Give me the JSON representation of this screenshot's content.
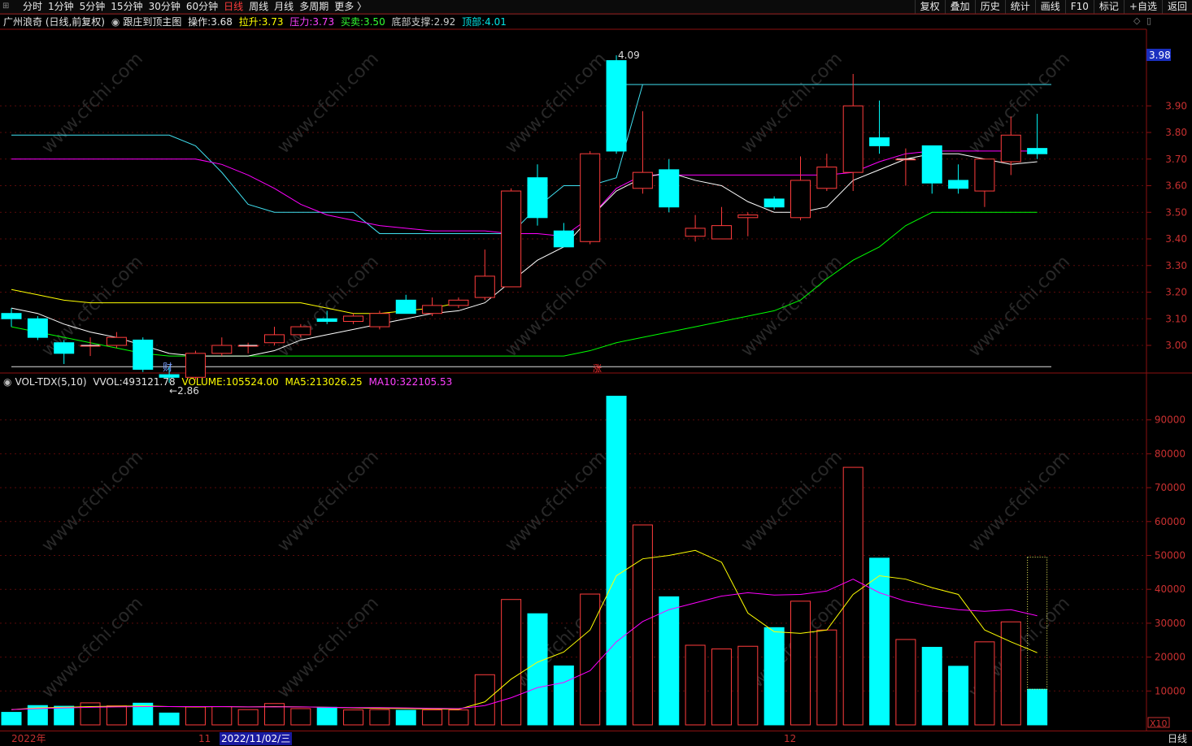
{
  "toolbar": {
    "periods": [
      "分时",
      "1分钟",
      "5分钟",
      "15分钟",
      "30分钟",
      "60分钟",
      "日线",
      "周线",
      "月线",
      "多周期",
      "更多 〉"
    ],
    "active_period": "日线",
    "tools": [
      "复权",
      "叠加",
      "历史",
      "统计",
      "画线",
      "F10",
      "标记",
      "+自选",
      "返回"
    ]
  },
  "price_panel": {
    "stock": "广州浪奇 (日线,前复权)",
    "indicator": "跟庄到顶主图",
    "op_label": "操作:",
    "op_value": "3.68",
    "lasheng_label": "拉升:",
    "lasheng_value": "3.73",
    "yali_label": "压力:",
    "yali_value": "3.73",
    "maimai_label": "买卖:",
    "maimai_value": "3.50",
    "dibu_label": "底部支撑:",
    "dibu_value": "2.92",
    "dingbu_label": "顶部:",
    "dingbu_value": "4.01",
    "current_price_tag": "3.98",
    "high_label": "4.09",
    "low_label": "←2.86",
    "marker_cai": "财",
    "marker_zhang": "涨",
    "yaxis": [
      "3.90",
      "3.80",
      "3.70",
      "3.60",
      "3.50",
      "3.40",
      "3.30",
      "3.20",
      "3.10",
      "3.00"
    ]
  },
  "volume_panel": {
    "name": "VOL-TDX(5,10)",
    "vvol_label": "VVOL:",
    "vvol_value": "493121.78",
    "volume_label": "VOLUME:",
    "volume_value": "105524.00",
    "ma5_label": "MA5:",
    "ma5_value": "213026.25",
    "ma10_label": "MA10:",
    "ma10_value": "322105.53",
    "yaxis": [
      "90000",
      "80000",
      "70000",
      "60000",
      "50000",
      "40000",
      "30000",
      "20000",
      "10000"
    ],
    "unit": "X10"
  },
  "bottom_bar": {
    "year": "2022年",
    "month1": "11",
    "cursor_date": "2022/11/02/三",
    "month2": "12",
    "period": "日线"
  },
  "watermark": "www.cfchi.com",
  "colors": {
    "up": "#ff3c3c",
    "down": "#00ffff",
    "ma5": "#ffffff",
    "ma10": "#ff00ff",
    "support": "#00ff00",
    "pressure": "#ffff00",
    "axis": "#8b1010"
  },
  "chart_data": {
    "type": "candlestick",
    "candles": [
      {
        "o": 3.12,
        "h": 3.14,
        "l": 3.07,
        "c": 3.1,
        "v": 3700
      },
      {
        "o": 3.1,
        "h": 3.11,
        "l": 3.02,
        "c": 3.03,
        "v": 5700
      },
      {
        "o": 3.01,
        "h": 3.02,
        "l": 2.93,
        "c": 2.97,
        "v": 5500
      },
      {
        "o": 3.0,
        "h": 3.03,
        "l": 2.96,
        "c": 3.0,
        "v": 6500
      },
      {
        "o": 3.0,
        "h": 3.05,
        "l": 2.99,
        "c": 3.03,
        "v": 5600
      },
      {
        "o": 3.02,
        "h": 3.03,
        "l": 2.9,
        "c": 2.91,
        "v": 6400
      },
      {
        "o": 2.89,
        "h": 2.92,
        "l": 2.86,
        "c": 2.88,
        "v": 3500
      },
      {
        "o": 2.88,
        "h": 2.98,
        "l": 2.87,
        "c": 2.97,
        "v": 5300
      },
      {
        "o": 2.97,
        "h": 3.03,
        "l": 2.96,
        "c": 3.0,
        "v": 5400
      },
      {
        "o": 3.0,
        "h": 3.01,
        "l": 2.97,
        "c": 3.0,
        "v": 4500
      },
      {
        "o": 3.01,
        "h": 3.07,
        "l": 3.0,
        "c": 3.04,
        "v": 6300
      },
      {
        "o": 3.04,
        "h": 3.08,
        "l": 3.03,
        "c": 3.07,
        "v": 4800
      },
      {
        "o": 3.1,
        "h": 3.13,
        "l": 3.08,
        "c": 3.09,
        "v": 5200
      },
      {
        "o": 3.09,
        "h": 3.12,
        "l": 3.08,
        "c": 3.11,
        "v": 4400
      },
      {
        "o": 3.07,
        "h": 3.13,
        "l": 3.06,
        "c": 3.12,
        "v": 4500
      },
      {
        "o": 3.17,
        "h": 3.19,
        "l": 3.12,
        "c": 3.12,
        "v": 4300
      },
      {
        "o": 3.12,
        "h": 3.18,
        "l": 3.11,
        "c": 3.15,
        "v": 4400
      },
      {
        "o": 3.15,
        "h": 3.18,
        "l": 3.14,
        "c": 3.17,
        "v": 4400
      },
      {
        "o": 3.18,
        "h": 3.36,
        "l": 3.17,
        "c": 3.26,
        "v": 14800
      },
      {
        "o": 3.22,
        "h": 3.59,
        "l": 3.22,
        "c": 3.58,
        "v": 37000
      },
      {
        "o": 3.63,
        "h": 3.68,
        "l": 3.45,
        "c": 3.48,
        "v": 32800
      },
      {
        "o": 3.43,
        "h": 3.46,
        "l": 3.37,
        "c": 3.37,
        "v": 17400
      },
      {
        "o": 3.39,
        "h": 3.73,
        "l": 3.38,
        "c": 3.72,
        "v": 38600
      },
      {
        "o": 4.07,
        "h": 4.09,
        "l": 3.72,
        "c": 3.73,
        "v": 97000
      },
      {
        "o": 3.59,
        "h": 3.88,
        "l": 3.57,
        "c": 3.65,
        "v": 59000
      },
      {
        "o": 3.66,
        "h": 3.7,
        "l": 3.5,
        "c": 3.52,
        "v": 37800
      },
      {
        "o": 3.41,
        "h": 3.49,
        "l": 3.39,
        "c": 3.44,
        "v": 23500
      },
      {
        "o": 3.4,
        "h": 3.52,
        "l": 3.4,
        "c": 3.45,
        "v": 22400
      },
      {
        "o": 3.48,
        "h": 3.5,
        "l": 3.41,
        "c": 3.49,
        "v": 23200
      },
      {
        "o": 3.55,
        "h": 3.56,
        "l": 3.51,
        "c": 3.52,
        "v": 28700
      },
      {
        "o": 3.48,
        "h": 3.71,
        "l": 3.47,
        "c": 3.62,
        "v": 36500
      },
      {
        "o": 3.59,
        "h": 3.72,
        "l": 3.58,
        "c": 3.67,
        "v": 28000
      },
      {
        "o": 3.65,
        "h": 4.02,
        "l": 3.58,
        "c": 3.9,
        "v": 76000
      },
      {
        "o": 3.78,
        "h": 3.92,
        "l": 3.72,
        "c": 3.75,
        "v": 49200
      },
      {
        "o": 3.7,
        "h": 3.74,
        "l": 3.6,
        "c": 3.7,
        "v": 25200
      },
      {
        "o": 3.75,
        "h": 3.75,
        "l": 3.57,
        "c": 3.61,
        "v": 22900
      },
      {
        "o": 3.62,
        "h": 3.68,
        "l": 3.57,
        "c": 3.59,
        "v": 17300
      },
      {
        "o": 3.58,
        "h": 3.7,
        "l": 3.52,
        "c": 3.7,
        "v": 24500
      },
      {
        "o": 3.69,
        "h": 3.86,
        "l": 3.64,
        "c": 3.79,
        "v": 30400
      },
      {
        "o": 3.74,
        "h": 3.87,
        "l": 3.7,
        "c": 3.72,
        "v": 10500
      }
    ],
    "ma5": [
      3.14,
      3.12,
      3.08,
      3.05,
      3.03,
      3.0,
      2.97,
      2.96,
      2.96,
      2.96,
      2.98,
      3.02,
      3.04,
      3.06,
      3.08,
      3.1,
      3.12,
      3.13,
      3.16,
      3.24,
      3.32,
      3.37,
      3.48,
      3.58,
      3.63,
      3.65,
      3.62,
      3.6,
      3.54,
      3.5,
      3.5,
      3.52,
      3.62,
      3.66,
      3.7,
      3.72,
      3.72,
      3.7,
      3.68,
      3.69
    ],
    "ma10_line": [
      3.7,
      3.7,
      3.7,
      3.7,
      3.7,
      3.7,
      3.7,
      3.7,
      3.68,
      3.64,
      3.59,
      3.53,
      3.49,
      3.47,
      3.45,
      3.44,
      3.43,
      3.43,
      3.43,
      3.42,
      3.42,
      3.41,
      3.48,
      3.59,
      3.64,
      3.64,
      3.64,
      3.64,
      3.64,
      3.64,
      3.64,
      3.64,
      3.65,
      3.69,
      3.72,
      3.73,
      3.73,
      3.73,
      3.73,
      3.73
    ],
    "support_line": [
      3.07,
      3.05,
      3.03,
      3.01,
      2.99,
      2.97,
      2.96,
      2.96,
      2.96,
      2.96,
      2.96,
      2.96,
      2.96,
      2.96,
      2.96,
      2.96,
      2.96,
      2.96,
      2.96,
      2.96,
      2.96,
      2.96,
      2.98,
      3.01,
      3.03,
      3.05,
      3.07,
      3.09,
      3.11,
      3.13,
      3.17,
      3.25,
      3.32,
      3.37,
      3.45,
      3.5,
      3.5,
      3.5,
      3.5,
      3.5
    ],
    "pressure_line": [
      3.21,
      3.19,
      3.17,
      3.16,
      3.16,
      3.16,
      3.16,
      3.16,
      3.16,
      3.16,
      3.16,
      3.16,
      3.14,
      3.12,
      3.12,
      3.13,
      3.14,
      3.16
    ],
    "cyan_line": [
      3.79,
      3.79,
      3.79,
      3.79,
      3.79,
      3.79,
      3.79,
      3.75,
      3.65,
      3.53,
      3.5,
      3.5,
      3.5,
      3.5,
      3.42,
      3.42,
      3.42,
      3.42,
      3.42,
      3.42,
      3.52,
      3.6,
      3.6,
      3.63,
      3.98
    ],
    "top_line": 3.98,
    "bottom_line": 2.92,
    "vol_ma5": [
      4500,
      5000,
      5200,
      5400,
      5500,
      5600,
      5400,
      5300,
      5400,
      5300,
      5400,
      5300,
      5200,
      5000,
      4900,
      4800,
      4700,
      4600,
      6800,
      13500,
      18500,
      21500,
      28000,
      44000,
      49000,
      50000,
      51500,
      48000,
      33000,
      27500,
      27000,
      28000,
      38500,
      44000,
      43000,
      40500,
      38500,
      28000,
      24500,
      21300
    ],
    "vol_ma10": [
      4500,
      4800,
      5000,
      5200,
      5300,
      5400,
      5400,
      5400,
      5400,
      5300,
      5300,
      5300,
      5200,
      5100,
      5100,
      5000,
      4900,
      4800,
      5700,
      8000,
      11000,
      12500,
      16000,
      24500,
      30500,
      34000,
      36000,
      38000,
      39000,
      38300,
      38500,
      39500,
      43000,
      39000,
      36500,
      35000,
      34000,
      33500,
      34000,
      32200
    ],
    "price_min": 2.85,
    "price_max": 4.1,
    "vol_max": 100000
  }
}
